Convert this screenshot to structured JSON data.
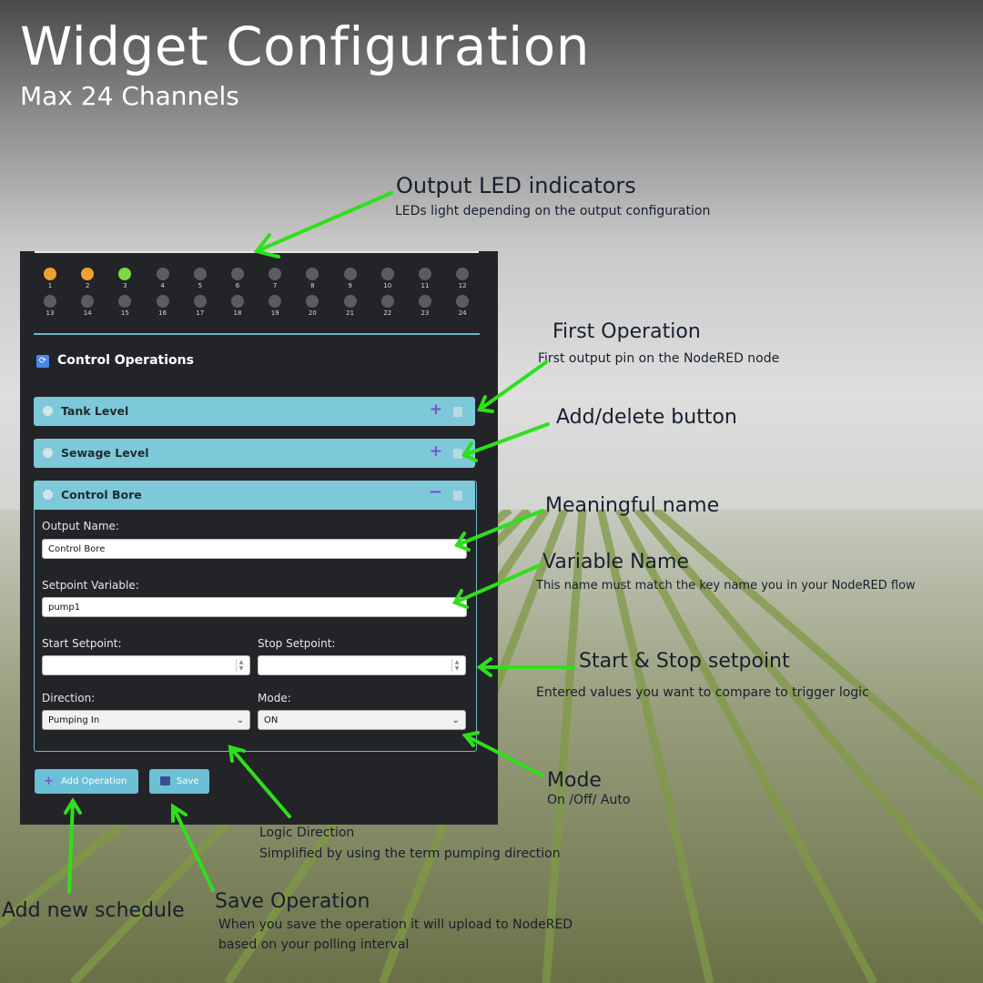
{
  "header": {
    "title": "Widget Configuration",
    "subtitle": "Max 24 Channels"
  },
  "leds": {
    "channels": [
      "1",
      "2",
      "3",
      "4",
      "5",
      "6",
      "7",
      "8",
      "9",
      "10",
      "11",
      "12",
      "13",
      "14",
      "15",
      "16",
      "17",
      "18",
      "19",
      "20",
      "21",
      "22",
      "23",
      "24"
    ],
    "states": [
      "orange",
      "orange",
      "green",
      "off",
      "off",
      "off",
      "off",
      "off",
      "off",
      "off",
      "off",
      "off",
      "off",
      "off",
      "off",
      "off",
      "off",
      "off",
      "off",
      "off",
      "off",
      "off",
      "off",
      "off"
    ]
  },
  "section": {
    "title": "Control Operations",
    "icon": "sync-icon"
  },
  "operations": [
    {
      "name": "Tank Level",
      "expanded": false
    },
    {
      "name": "Sewage Level",
      "expanded": false
    },
    {
      "name": "Control Bore",
      "expanded": true
    }
  ],
  "form": {
    "output_name_label": "Output Name:",
    "output_name_value": "Control Bore",
    "setpoint_variable_label": "Setpoint Variable:",
    "setpoint_variable_value": "pump1",
    "start_setpoint_label": "Start Setpoint:",
    "stop_setpoint_label": "Stop Setpoint:",
    "direction_label": "Direction:",
    "direction_value": "Pumping In",
    "mode_label": "Mode:",
    "mode_value": "ON"
  },
  "buttons": {
    "add_operation": "Add Operation",
    "save": "Save"
  },
  "annotations": {
    "output_led_title": "Output LED indicators",
    "output_led_desc": "LEDs  light depending on the output configuration",
    "first_op_title": "First Operation",
    "first_op_desc": "First output pin on the NodeRED node",
    "add_delete_title": "Add/delete button",
    "meaningful_name_title": "Meaningful name",
    "variable_name_title": "Variable Name",
    "variable_name_desc": "This name must match the key name you  in your NodeRED flow",
    "start_stop_title": "Start & Stop setpoint",
    "start_stop_desc": "Entered values you want to compare to trigger logic",
    "mode_title": "Mode",
    "mode_desc": "On /Off/ Auto",
    "logic_direction_title": "Logic Direction",
    "logic_direction_desc": "Simplified by using the term pumping direction",
    "add_schedule_title": "Add new schedule",
    "save_op_title": "Save Operation",
    "save_op_desc_1": "When you save the operation it will upload to NodeRED",
    "save_op_desc_2": "based on your polling interval"
  },
  "colors": {
    "panel": "#232428",
    "accent": "#7dc9d9",
    "arrow": "#2ee01b",
    "led_orange": "#f0a030",
    "led_green": "#7bd946",
    "led_off": "#5b5c60"
  }
}
